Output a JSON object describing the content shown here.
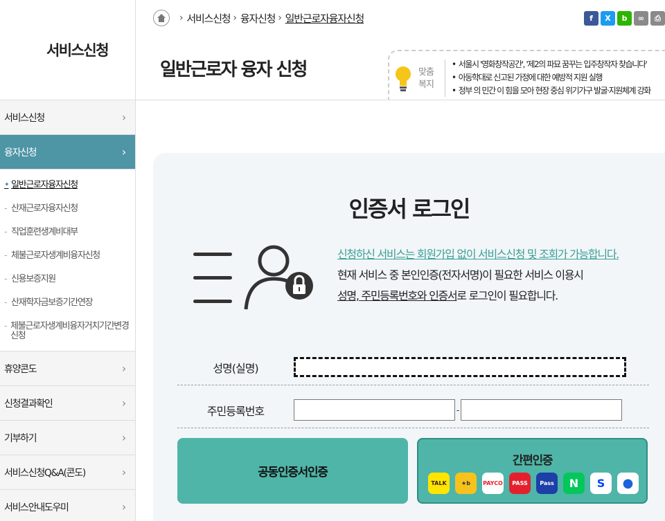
{
  "sidebar": {
    "title": "서비스신청",
    "menu": [
      {
        "label": "서비스신청"
      },
      {
        "label": "융자신청"
      },
      {
        "label": "휴양콘도"
      },
      {
        "label": "신청결과확인"
      },
      {
        "label": "기부하기"
      },
      {
        "label": "서비스신청Q&A(콘도)"
      },
      {
        "label": "서비스안내도우미"
      }
    ],
    "submenu": [
      {
        "label": "일반근로자융자신청"
      },
      {
        "label": "산재근로자융자신청"
      },
      {
        "label": "직업훈련생계비대부"
      },
      {
        "label": "체불근로자생계비융자신청"
      },
      {
        "label": "신용보증지원"
      },
      {
        "label": "산재학자금보증기간연장"
      },
      {
        "label": "체불근로자생계비융자거치기간변경신청"
      }
    ]
  },
  "breadcrumb": [
    "서비스신청",
    "융자신청",
    "일반근로자융자신청"
  ],
  "page_title": "일반근로자 융자 신청",
  "welfare": {
    "label": "맞춤 복지",
    "items": [
      "서울시 '영화창작공간', '제2의 파묘 꿈꾸는 입주창작자 찾습니다'",
      "아동학대로 신고된 가정에 대한 예방적 지원 실행",
      "정부 의 민간 이 힘을 모아 현장 중심 위기가구 발굴·지원체계 강화"
    ]
  },
  "login": {
    "title": "인증서 로그인",
    "notice_line1": "신청하신 서비스는 회원가입 없이 서비스신청 및 조회가 가능합니다.",
    "notice_line2": "현재 서비스 중 본인인증(전자서명)이 필요한 서비스 이용시",
    "notice_line3_a": "성명, 주민등록번호와 인증서",
    "notice_line3_b": "로 로그인이 필요합니다.",
    "name_label": "성명(실명)",
    "rrn_label": "주민등록번호",
    "rrn_dash": "-",
    "cert_button": "공동인증서인증",
    "simple_button": "간편인증",
    "providers": [
      {
        "name": "kakao",
        "text": "TALK",
        "bg": "#fee500",
        "fg": "#3a1d1d"
      },
      {
        "name": "kb",
        "text": "★b",
        "bg": "#f7c21c",
        "fg": "#333"
      },
      {
        "name": "payco",
        "text": "PAYCO",
        "bg": "#ffffff",
        "fg": "#e5202e"
      },
      {
        "name": "pass",
        "text": "PASS",
        "bg": "#e5202e",
        "fg": "#ffffff"
      },
      {
        "name": "samsung-pass",
        "text": "Pass",
        "bg": "#1c3fa8",
        "fg": "#ffffff"
      },
      {
        "name": "naver",
        "text": "N",
        "bg": "#03c75a",
        "fg": "#ffffff"
      },
      {
        "name": "shinhan",
        "text": "S",
        "bg": "#ffffff",
        "fg": "#0046ff"
      },
      {
        "name": "toss",
        "text": "●",
        "bg": "#ffffff",
        "fg": "#1b64da"
      }
    ]
  },
  "colors": {
    "accent": "#4e95a6",
    "button": "#4fb5a8",
    "teal_text": "#3a9f95"
  }
}
